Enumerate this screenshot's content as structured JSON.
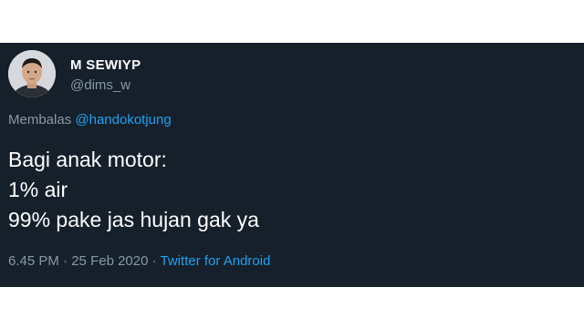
{
  "user": {
    "display_name": "M SEWIYP",
    "handle": "@dims_w"
  },
  "reply": {
    "prefix": "Membalas",
    "to_handle": "@handokotjung"
  },
  "tweet": {
    "lines": [
      "Bagi anak motor:",
      "1% air",
      "99% pake jas hujan gak ya"
    ]
  },
  "meta": {
    "time": "6.45 PM",
    "separator_1": " · ",
    "date": "25 Feb 2020",
    "separator_2": " · ",
    "source": "Twitter for Android"
  },
  "colors": {
    "background": "#15202b",
    "text_primary": "#ffffff",
    "text_secondary": "#8899a6",
    "link": "#1da1f2"
  },
  "icons": {
    "avatar": "user-avatar-photo"
  }
}
